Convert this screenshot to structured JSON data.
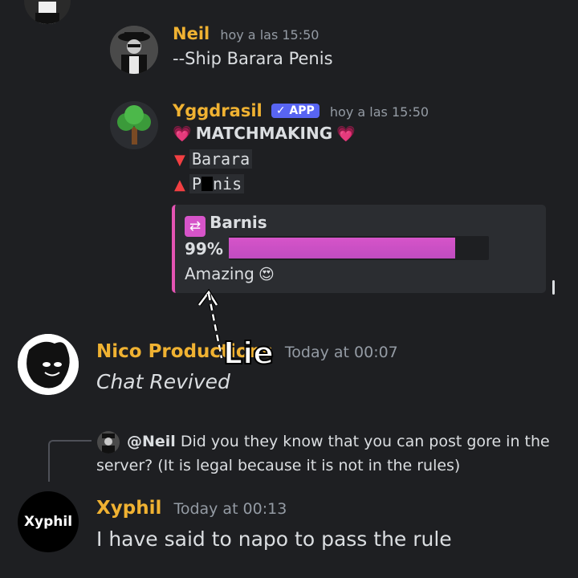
{
  "messages": {
    "neil": {
      "author": "Neil",
      "timestamp": "hoy a las 15:50",
      "text": "--Ship Barara Penis"
    },
    "yggdrasil": {
      "author": "Yggdrasil",
      "badge": "✓ APP",
      "timestamp": "hoy a las 15:50",
      "title": "MATCHMAKING",
      "line1_name": "Barara",
      "line2_prefix": "P",
      "line2_suffix": "nis",
      "embed": {
        "title": "Barnis",
        "percent_label": "99%",
        "progress_fraction": 0.99,
        "verdict": "Amazing"
      }
    },
    "annotation": {
      "text": "Lie"
    },
    "nico": {
      "author": "Nico Productions",
      "timestamp": "Today at 00:07",
      "text": "Chat Revived"
    },
    "xyphil": {
      "avatar_text": "Xyphil",
      "reply_mention": "@Neil",
      "reply_line1": "Did you they know that you can post gore in the",
      "reply_line2": "server? (It is legal because it is not in the rules)",
      "author": "Xyphil",
      "timestamp": "Today at 00:13",
      "text": "I have said to napo to pass the rule"
    }
  },
  "colors": {
    "background": "#1e1f22",
    "username_gold": "#f0b232",
    "embed_accent": "#e454b3",
    "app_badge": "#5865f2",
    "progress_fill": "#d654c9"
  }
}
